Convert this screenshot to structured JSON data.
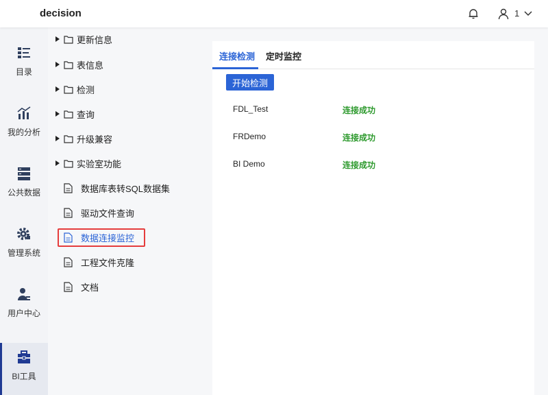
{
  "header": {
    "title": "decision",
    "user": "1"
  },
  "rail": [
    {
      "label": "目录",
      "icon": "catalog-icon"
    },
    {
      "label": "我的分析",
      "icon": "analysis-icon"
    },
    {
      "label": "公共数据",
      "icon": "database-icon"
    },
    {
      "label": "管理系统",
      "icon": "gear-icon"
    },
    {
      "label": "用户中心",
      "icon": "user-center-icon"
    },
    {
      "label": "BI工具",
      "icon": "toolbox-icon",
      "active": true
    }
  ],
  "tree": {
    "folders": [
      "更新信息",
      "表信息",
      "检测",
      "查询",
      "升级兼容",
      "实验室功能"
    ],
    "docs": [
      "数据库表转SQL数据集",
      "驱动文件查询",
      "数据连接监控",
      "工程文件克隆",
      "文档"
    ],
    "selected": "数据连接监控"
  },
  "main": {
    "tabs": [
      "连接检测",
      "定时监控"
    ],
    "start_button": "开始检测",
    "connections": [
      {
        "name": "FDL_Test",
        "status": "连接成功"
      },
      {
        "name": "FRDemo",
        "status": "连接成功"
      },
      {
        "name": "BI Demo",
        "status": "连接成功"
      }
    ]
  },
  "colors": {
    "accent": "#2b64d6",
    "success": "#2e9a2e",
    "highlight": "#e53c3c"
  }
}
